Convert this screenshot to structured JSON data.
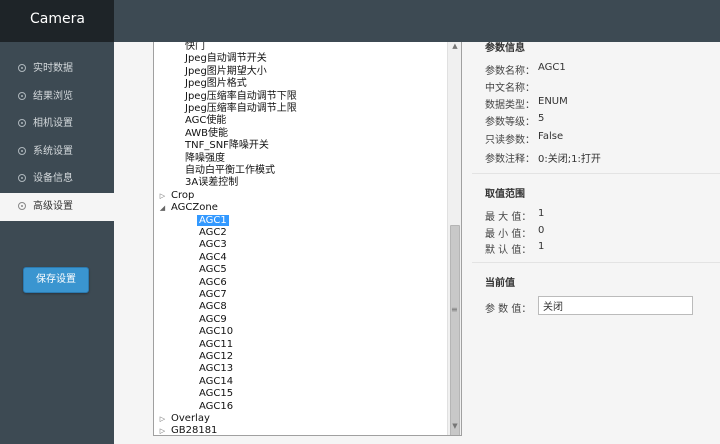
{
  "app": {
    "title": "Camera"
  },
  "sidebar": {
    "items": [
      {
        "label": "实时数据",
        "active": false
      },
      {
        "label": "结果浏览",
        "active": false
      },
      {
        "label": "相机设置",
        "active": false
      },
      {
        "label": "系统设置",
        "active": false
      },
      {
        "label": "设备信息",
        "active": false
      },
      {
        "label": "高级设置",
        "active": true
      }
    ],
    "save_label": "保存设置"
  },
  "tree": {
    "top_items": [
      "快门",
      "Jpeg自动调节开关",
      "Jpeg图片期望大小",
      "Jpeg图片格式",
      "Jpeg压缩率自动调节下限",
      "Jpeg压缩率自动调节上限",
      "AGC使能",
      "AWB使能",
      "TNF_SNF降噪开关",
      "降噪强度",
      "自动白平衡工作模式",
      "3A误差控制"
    ],
    "crop": "Crop",
    "agczone": "AGCZone",
    "agc_children": [
      "AGC1",
      "AGC2",
      "AGC3",
      "AGC4",
      "AGC5",
      "AGC6",
      "AGC7",
      "AGC8",
      "AGC9",
      "AGC10",
      "AGC11",
      "AGC12",
      "AGC13",
      "AGC14",
      "AGC15",
      "AGC16"
    ],
    "selected": "AGC1",
    "overlay": "Overlay",
    "gb28181": "GB28181"
  },
  "params": {
    "section_title": "参数信息",
    "rows": [
      {
        "label": "参数名称：",
        "value": "AGC1"
      },
      {
        "label": "中文名称：",
        "value": ""
      },
      {
        "label": "数据类型：",
        "value": "ENUM"
      },
      {
        "label": "参数等级：",
        "value": "5"
      },
      {
        "label": "只读参数：",
        "value": "False"
      },
      {
        "label": "参数注释：",
        "value": "0:关闭;1:打开"
      }
    ]
  },
  "range": {
    "section_title": "取值范围",
    "rows": [
      {
        "label": "最 大 值：",
        "value": "1"
      },
      {
        "label": "最 小 值：",
        "value": "0"
      },
      {
        "label": "默 认 值：",
        "value": "1"
      }
    ]
  },
  "current": {
    "section_title": "当前值",
    "label": "参 数 值：",
    "value": "关闭"
  }
}
